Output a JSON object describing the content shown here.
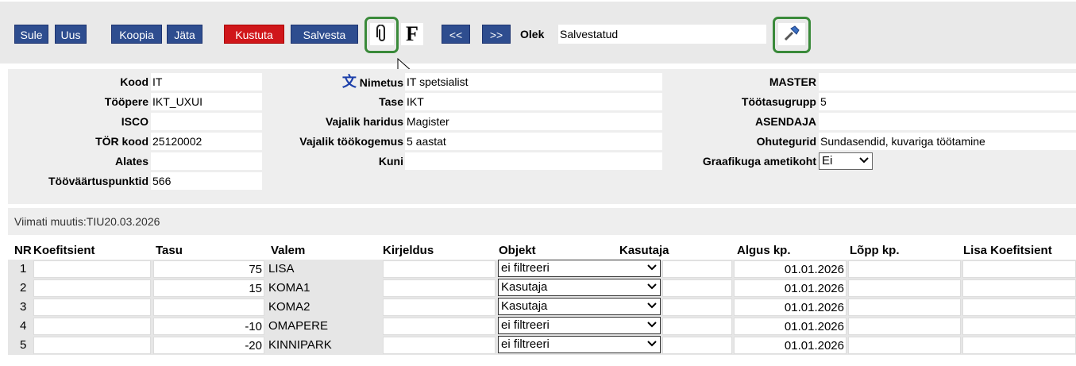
{
  "toolbar": {
    "sule": "Sule",
    "uus": "Uus",
    "koopia": "Koopia",
    "jata": "Jäta",
    "kustuta": "Kustuta",
    "salvesta": "Salvesta",
    "f_label": "F",
    "prev": "<<",
    "next": ">>",
    "olek_label": "Olek",
    "olek_value": "Salvestatud",
    "attach_icon": "paperclip-icon",
    "tool_icon": "hammer-icon",
    "highlight_color": "#3a8a3a",
    "primary_color": "#2e4d8f",
    "danger_color": "#d0161a"
  },
  "header": {
    "kood_label": "Kood",
    "kood": "IT",
    "toopere_label": "Tööpere",
    "toopere": "IKT_UXUI",
    "isco_label": "ISCO",
    "isco": "",
    "tor_label": "TÖR kood",
    "tor": "25120002",
    "alates_label": "Alates",
    "alates": "",
    "tvp_label": "Tööväärtuspunktid",
    "tvp": "566",
    "translate_icon": "文",
    "nimetus_label": "Nimetus",
    "nimetus": "IT spetsialist",
    "tase_label": "Tase",
    "tase": "IKT",
    "haridus_label": "Vajalik haridus",
    "haridus": "Magister",
    "kogemus_label": "Vajalik töökogemus",
    "kogemus": "5 aastat",
    "kuni_label": "Kuni",
    "kuni": "",
    "master_label": "MASTER",
    "master": "",
    "tootasu_label": "Töötasugrupp",
    "tootasu": "5",
    "asendaja_label": "ASENDAJA",
    "asendaja": "",
    "ohutegurid_label": "Ohutegurid",
    "ohutegurid": "Sundasendid, kuvariga töötamine",
    "graafik_label": "Graafikuga ametikoht",
    "graafik": "Ei"
  },
  "meta": "Viimati muutis:TIU20.03.2026",
  "table": {
    "headers": [
      "NR",
      "Koefitsient",
      "Tasu",
      "Valem",
      "Kirjeldus",
      "Objekt",
      "Kasutaja",
      "Algus kp.",
      "Lõpp kp.",
      "Lisa Koefitsient"
    ],
    "rows": [
      {
        "nr": "1",
        "tasu": "75",
        "valem": "LISA",
        "objekt": "ei filtreeri",
        "algus": "01.01.2026"
      },
      {
        "nr": "2",
        "tasu": "15",
        "valem": "KOMA1",
        "objekt": "Kasutaja",
        "algus": "01.01.2026"
      },
      {
        "nr": "3",
        "tasu": "",
        "valem": "KOMA2",
        "objekt": "Kasutaja",
        "algus": "01.01.2026"
      },
      {
        "nr": "4",
        "tasu": "-10",
        "valem": "OMAPERE",
        "objekt": "ei filtreeri",
        "algus": "01.01.2026"
      },
      {
        "nr": "5",
        "tasu": "-20",
        "valem": "KINNIPARK",
        "objekt": "ei filtreeri",
        "algus": "01.01.2026"
      }
    ]
  }
}
